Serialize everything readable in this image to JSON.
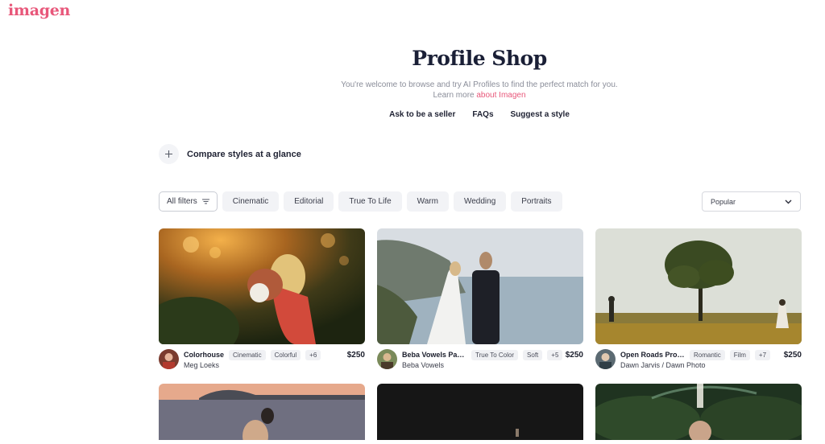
{
  "brand": {
    "logo": "imagen"
  },
  "hero": {
    "title": "Profile Shop",
    "subtitle": "You're welcome to browse and try AI Profiles to find the perfect match for you.",
    "learn_prefix": "Learn more ",
    "learn_link": "about Imagen",
    "links": [
      "Ask to be a seller",
      "FAQs",
      "Suggest a style"
    ]
  },
  "compare": {
    "label": "Compare styles at a glance"
  },
  "filters": {
    "all_label": "All filters",
    "chips": [
      "Cinematic",
      "Editorial",
      "True To Life",
      "Warm",
      "Wedding",
      "Portraits"
    ]
  },
  "sort": {
    "selected": "Popular"
  },
  "profiles": [
    {
      "title": "Colorhouse",
      "tags": [
        "Cinematic",
        "Colorful",
        "+6"
      ],
      "price": "$250",
      "author": "Meg Loeks"
    },
    {
      "title": "Beba Vowels Pac...",
      "tags": [
        "True To Color",
        "Soft",
        "+5"
      ],
      "price": "$250",
      "author": "Beba Vowels"
    },
    {
      "title": "Open Roads Profile",
      "tags": [
        "Romantic",
        "Film",
        "+7"
      ],
      "price": "$250",
      "author": "Dawn Jarvis / Dawn Photo"
    }
  ],
  "icons": {
    "plus": "plus-icon",
    "filter": "filter-lines-icon",
    "chevron": "chevron-down-icon"
  },
  "colors": {
    "brand": "#e8577a",
    "text": "#1a1f36"
  }
}
